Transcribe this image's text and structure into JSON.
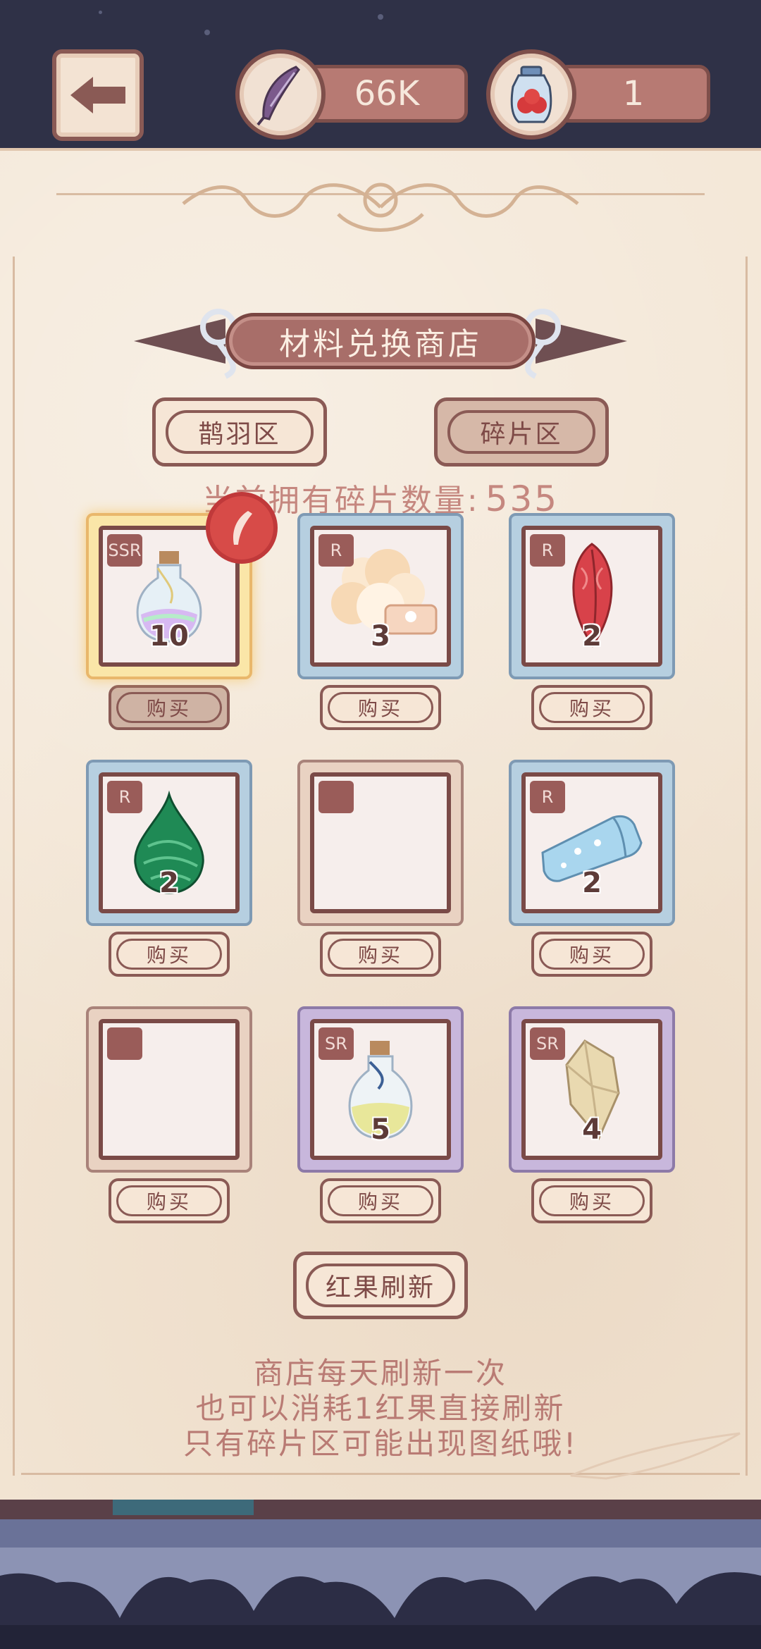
{
  "header": {
    "feather_count": "66K",
    "berry_count": "1",
    "back_icon": "arrow-left-icon",
    "feather_icon": "feather-icon",
    "berry_icon": "berry-jar-icon"
  },
  "shop": {
    "title": "材料兑换商店",
    "tabs": [
      {
        "label": "鹊羽区",
        "active": false
      },
      {
        "label": "碎片区",
        "active": true
      }
    ],
    "fragment_label": "当前拥有碎片数量:",
    "fragment_count": "535",
    "items": [
      {
        "rarity": "SSR",
        "count": "10",
        "icon": "rainbow-potion-icon",
        "buy": "购买",
        "sold": true
      },
      {
        "rarity": "R",
        "count": "3",
        "icon": "cotton-cloud-icon",
        "buy": "购买",
        "sold": false
      },
      {
        "rarity": "R",
        "count": "2",
        "icon": "red-feather-icon",
        "buy": "购买",
        "sold": false
      },
      {
        "rarity": "R",
        "count": "2",
        "icon": "malachite-gem-icon",
        "buy": "购买",
        "sold": false
      },
      {
        "rarity": "",
        "count": "",
        "icon": "empty-slot-icon",
        "buy": "购买",
        "sold": false
      },
      {
        "rarity": "R",
        "count": "2",
        "icon": "blue-cloth-icon",
        "buy": "购买",
        "sold": false
      },
      {
        "rarity": "",
        "count": "",
        "icon": "empty-slot-icon",
        "buy": "购买",
        "sold": false
      },
      {
        "rarity": "SR",
        "count": "5",
        "icon": "yellow-potion-icon",
        "buy": "购买",
        "sold": false
      },
      {
        "rarity": "SR",
        "count": "4",
        "icon": "crystal-icon",
        "buy": "购买",
        "sold": false
      }
    ],
    "refresh_label": "红果刷新",
    "notes": [
      "商店每天刷新一次",
      "也可以消耗1红果直接刷新",
      "只有碎片区可能出现图纸哦!"
    ]
  },
  "colors": {
    "panel": "#f3e6d5",
    "accent": "#a86e69",
    "frame_R": "#b6cfe0",
    "frame_SR": "#c8b7dc",
    "frame_SSR": "#fae6a8"
  }
}
